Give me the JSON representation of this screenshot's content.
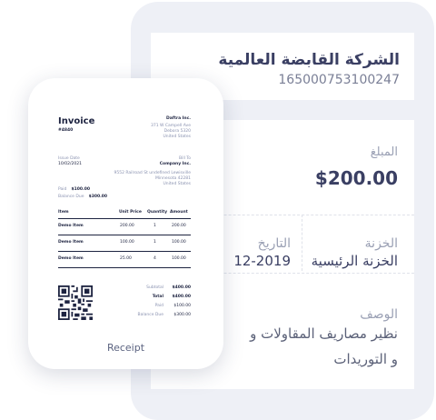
{
  "company_card": {
    "name": "الشركة القابضة العالمية",
    "id": "165000753100247"
  },
  "detail_card": {
    "amount_label": "المبلغ",
    "amount_value": "$200.00",
    "treasury_label": "الخزنة",
    "treasury_value": "الخزنة الرئيسية",
    "date_label": "التاريخ",
    "date_value": "12-2019",
    "description_label": "الوصف",
    "description_line1": "نظير مصاريف المقاولات و",
    "description_line2": "و التوريدات"
  },
  "receipt": {
    "title": "Invoice",
    "number": "#4840",
    "company": "Daftra Inc.",
    "company_addr1": "371 W Campell Ave",
    "company_addr2": "Debora 5320",
    "company_addr3": "United States",
    "issue_label": "Issue Date",
    "issue_value": "10/02/2021",
    "paid_label": "Paid",
    "paid_value": "$100.00",
    "due_label": "Balance Due",
    "due_value": "$300.00",
    "billto_label": "Bill To",
    "billto_name": "Company Inc.",
    "billto_addr1": "9552 Railroad St undefined Lewisville",
    "billto_addr2": "Minnesota 42281",
    "billto_addr3": "United States",
    "columns": [
      "Item",
      "Unit Price",
      "Quantity",
      "Amount"
    ],
    "rows": [
      [
        "Demo Item",
        "200.00",
        "1",
        "200.00"
      ],
      [
        "Demo Item",
        "100.00",
        "1",
        "100.00"
      ],
      [
        "Demo Item",
        "25.00",
        "4",
        "100.00"
      ]
    ],
    "totals": [
      [
        "Subtotal",
        "$400.00"
      ],
      [
        "Total",
        "$400.00"
      ],
      [
        "Paid",
        "$100.00"
      ],
      [
        "Balance Due",
        "$300.00"
      ]
    ],
    "footer_label": "Receipt"
  }
}
